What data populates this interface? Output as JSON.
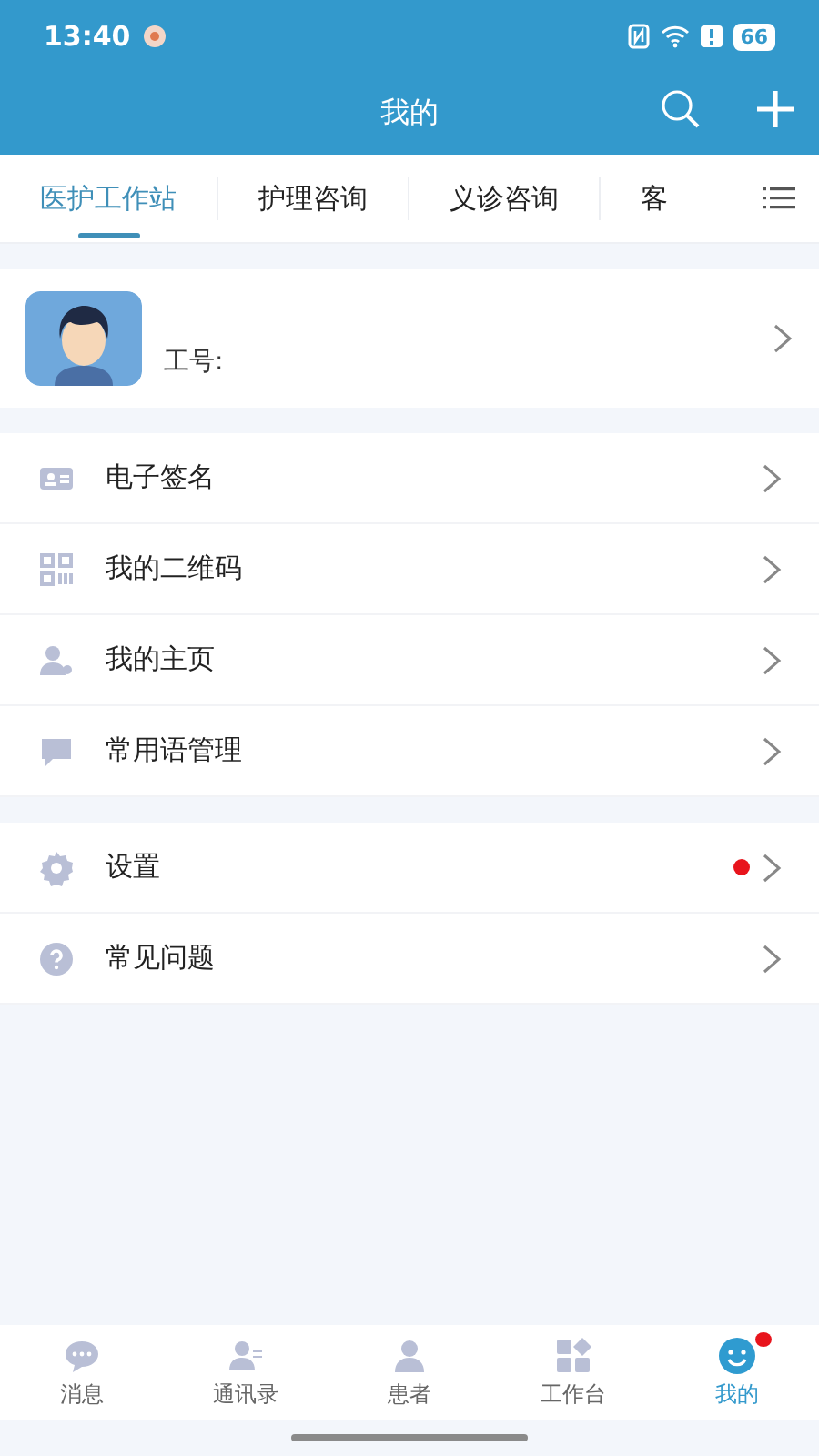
{
  "status_bar": {
    "time": "13:40",
    "battery": "66"
  },
  "header": {
    "title": "我的"
  },
  "tabs": [
    {
      "label": "医护工作站",
      "selected": true
    },
    {
      "label": "护理咨询",
      "selected": false
    },
    {
      "label": "义诊咨询",
      "selected": false
    },
    {
      "label": "客",
      "selected": false
    }
  ],
  "profile": {
    "employee_id_label": "工号:"
  },
  "menu_groups": [
    [
      {
        "kind": "card",
        "label": "电子签名",
        "badge": false
      },
      {
        "kind": "qr",
        "label": "我的二维码",
        "badge": false
      },
      {
        "kind": "person",
        "label": "我的主页",
        "badge": false
      },
      {
        "kind": "chat",
        "label": "常用语管理",
        "badge": false
      }
    ],
    [
      {
        "kind": "gear",
        "label": "设置",
        "badge": true
      },
      {
        "kind": "question",
        "label": "常见问题",
        "badge": false
      }
    ]
  ],
  "bottom_nav": [
    {
      "kind": "chat",
      "label": "消息",
      "selected": false,
      "badge": false
    },
    {
      "kind": "contacts",
      "label": "通讯录",
      "selected": false,
      "badge": false
    },
    {
      "kind": "person",
      "label": "患者",
      "selected": false,
      "badge": false
    },
    {
      "kind": "grid",
      "label": "工作台",
      "selected": false,
      "badge": false
    },
    {
      "kind": "smile",
      "label": "我的",
      "selected": true,
      "badge": true
    }
  ]
}
